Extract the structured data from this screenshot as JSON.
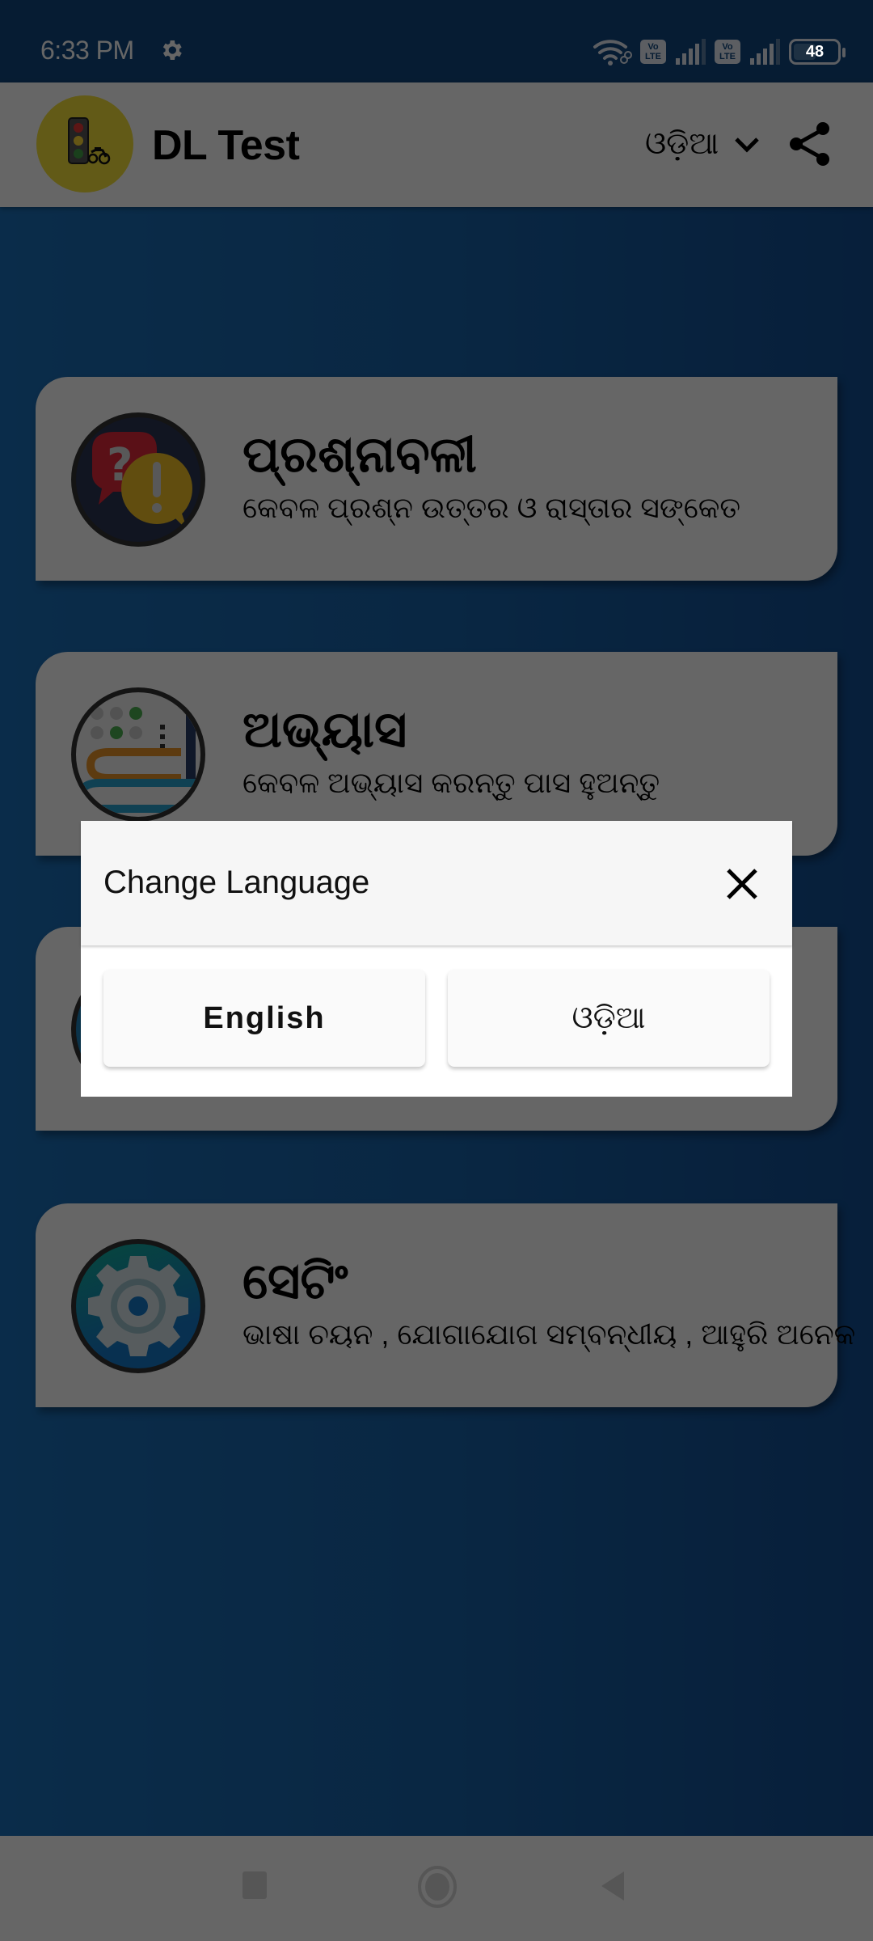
{
  "status_bar": {
    "time": "6:33 PM",
    "settings_icon": "gear-icon",
    "wifi_icon": "wifi-link-icon",
    "sim1_badge": "Vo LTE",
    "sim2_badge": "Vo LTE",
    "battery_level": "48"
  },
  "app_bar": {
    "title": "DL Test",
    "logo_icon": "traffic-light-motorcycle-logo",
    "language_selected": "ଓଡ଼ିଆ",
    "dropdown_icon": "chevron-down-icon",
    "share_icon": "share-icon"
  },
  "menu": {
    "items": [
      {
        "title": "ପ୍ରଶ୍ନାବଳୀ",
        "subtitle": "କେବଳ ପ୍ରଶ୍ନ  ଉତ୍ତର ଓ ରାସ୍ତାର ସଙ୍କେତ",
        "icon": "question-answer-bubbles-icon"
      },
      {
        "title": "ଅଭ୍ୟାସ",
        "subtitle": "କେବଳ ଅଭ୍ୟାସ କରନ୍ତୁ ପାସ ହୁଅନ୍ତୁ",
        "icon": "practice-books-icon"
      },
      {
        "title": "",
        "subtitle": "",
        "icon": "hidden-card-icon"
      },
      {
        "title": "ସେଟିଂ",
        "subtitle": "ଭାଷା ଚୟନ , ଯୋଗାଯୋଗ ସମ୍ବନ୍ଧୀୟ , ଆହୁରି ଅନେକ",
        "icon": "settings-gear-icon"
      }
    ]
  },
  "dialog": {
    "title": "Change Language",
    "close_icon": "close-icon",
    "options": [
      {
        "label": "English"
      },
      {
        "label": "ଓଡ଼ିଆ"
      }
    ]
  },
  "nav_bar": {
    "recents_icon": "square-recents-icon",
    "home_icon": "circle-home-icon",
    "back_icon": "triangle-back-icon"
  },
  "colors": {
    "status_bar_bg": "#11477f",
    "background_gradient_start": "#1a6fb8",
    "background_gradient_end": "#124e92",
    "card_bg": "#ffffff",
    "logo_bg": "#f5e03a",
    "scrim": "rgba(0,0,0,0.6)"
  }
}
